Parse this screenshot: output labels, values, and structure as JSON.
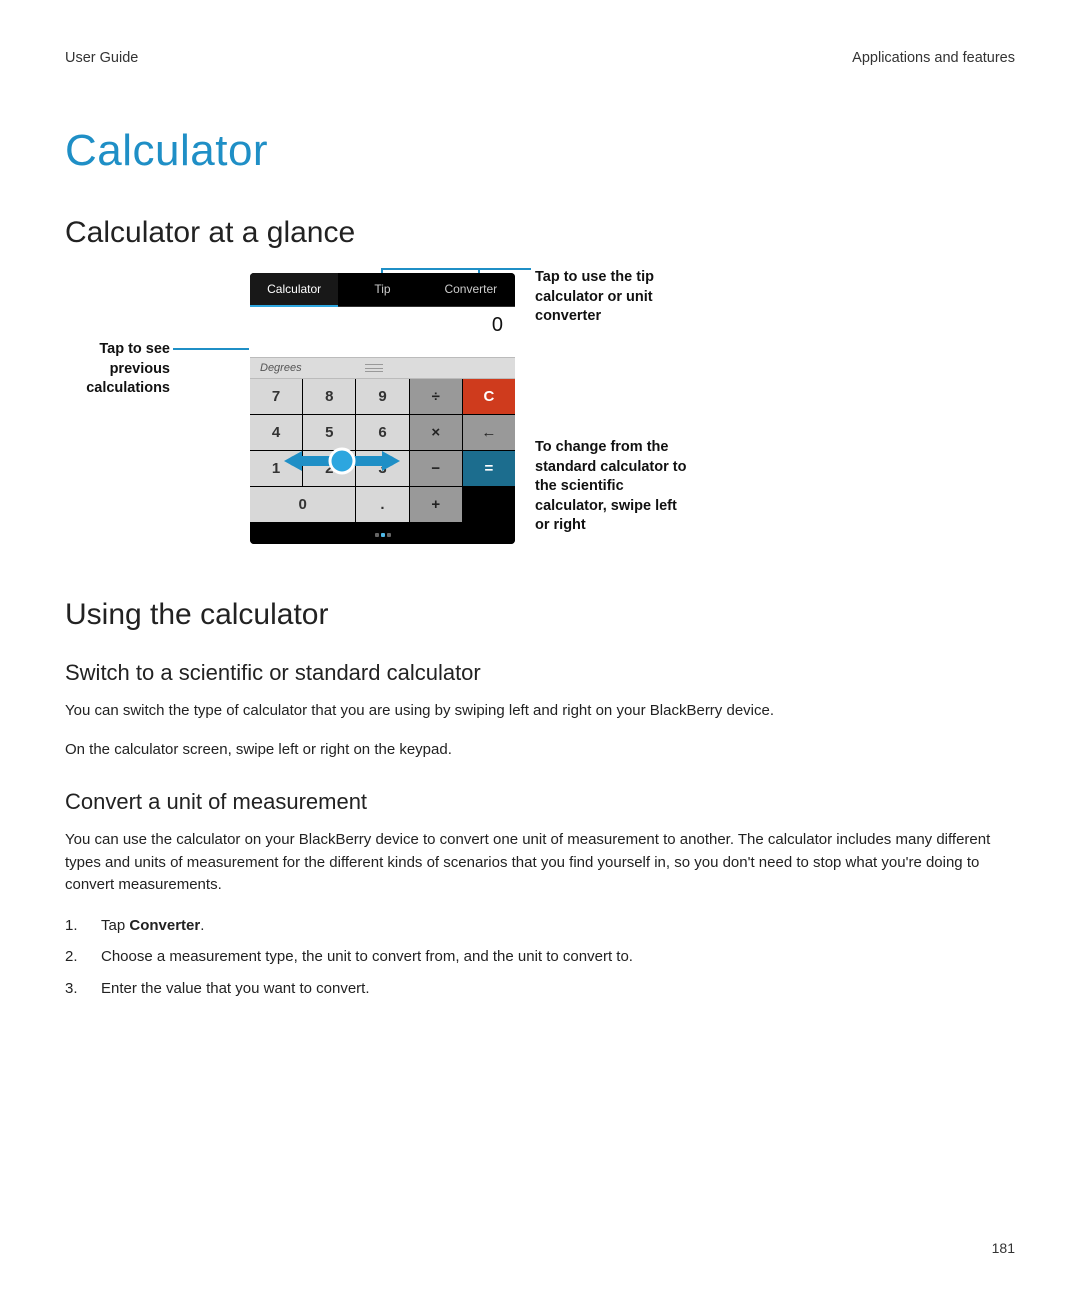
{
  "header": {
    "left": "User Guide",
    "right": "Applications and features"
  },
  "title": "Calculator",
  "section1": {
    "heading": "Calculator at a glance",
    "callouts": {
      "left": "Tap to see previous calculations",
      "rightTop": "Tap to use the tip calculator or unit converter",
      "rightBottom": "To change from the standard calculator to the scientific calculator, swipe left or right"
    },
    "calc": {
      "tabs": [
        "Calculator",
        "Tip",
        "Converter"
      ],
      "display": "0",
      "degrees": "Degrees",
      "keys": {
        "r1": [
          "7",
          "8",
          "9",
          "÷",
          "C"
        ],
        "r2": [
          "4",
          "5",
          "6",
          "×",
          "←"
        ],
        "r3": [
          "1",
          "2",
          "3",
          "−",
          "="
        ],
        "r4": [
          "0",
          ".",
          "+"
        ]
      }
    }
  },
  "section2": {
    "heading": "Using the calculator",
    "sub1": {
      "heading": "Switch to a scientific or standard calculator",
      "p1": "You can switch the type of calculator that you are using by swiping left and right on your BlackBerry device.",
      "p2": "On the calculator screen, swipe left or right on the keypad."
    },
    "sub2": {
      "heading": "Convert a unit of measurement",
      "p1": "You can use the calculator on your BlackBerry device to convert one unit of measurement to another. The calculator includes many different types and units of measurement for the different kinds of scenarios that you find yourself in, so you don't need to stop what you're doing to convert measurements.",
      "steps": {
        "s1_pre": "Tap ",
        "s1_bold": "Converter",
        "s1_post": ".",
        "s2": "Choose a measurement type, the unit to convert from, and the unit to convert to.",
        "s3": "Enter the value that you want to convert."
      }
    }
  },
  "pageNumber": "181"
}
